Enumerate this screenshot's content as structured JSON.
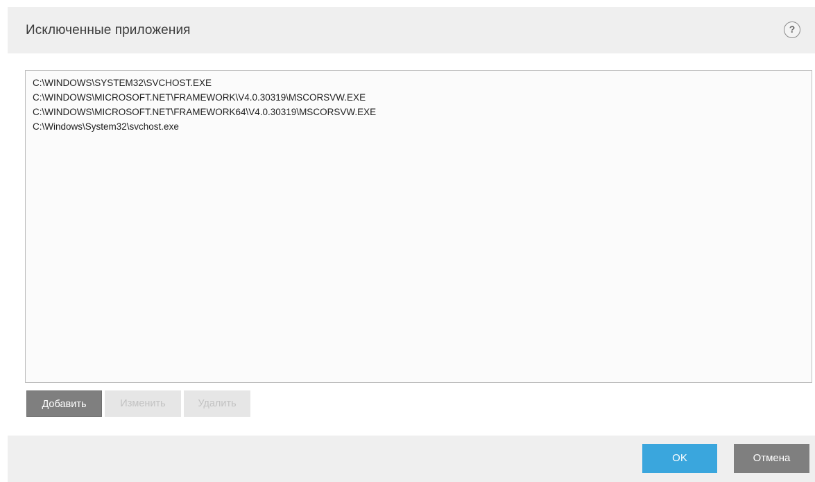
{
  "dialog": {
    "title": "Исключенные приложения",
    "help_label": "?"
  },
  "list": {
    "items": [
      "C:\\WINDOWS\\SYSTEM32\\SVCHOST.EXE",
      "C:\\WINDOWS\\MICROSOFT.NET\\FRAMEWORK\\V4.0.30319\\MSCORSVW.EXE",
      "C:\\WINDOWS\\MICROSOFT.NET\\FRAMEWORK64\\V4.0.30319\\MSCORSVW.EXE",
      "C:\\Windows\\System32\\svchost.exe"
    ]
  },
  "toolbar": {
    "add_label": "Добавить",
    "edit_label": "Изменить",
    "delete_label": "Удалить"
  },
  "footer": {
    "ok_label": "OK",
    "cancel_label": "Отмена"
  },
  "colors": {
    "accent": "#3aa6dd",
    "button_gray": "#7f7f7f",
    "header_bg": "#efefef"
  },
  "icons": {
    "help": "help-icon"
  }
}
